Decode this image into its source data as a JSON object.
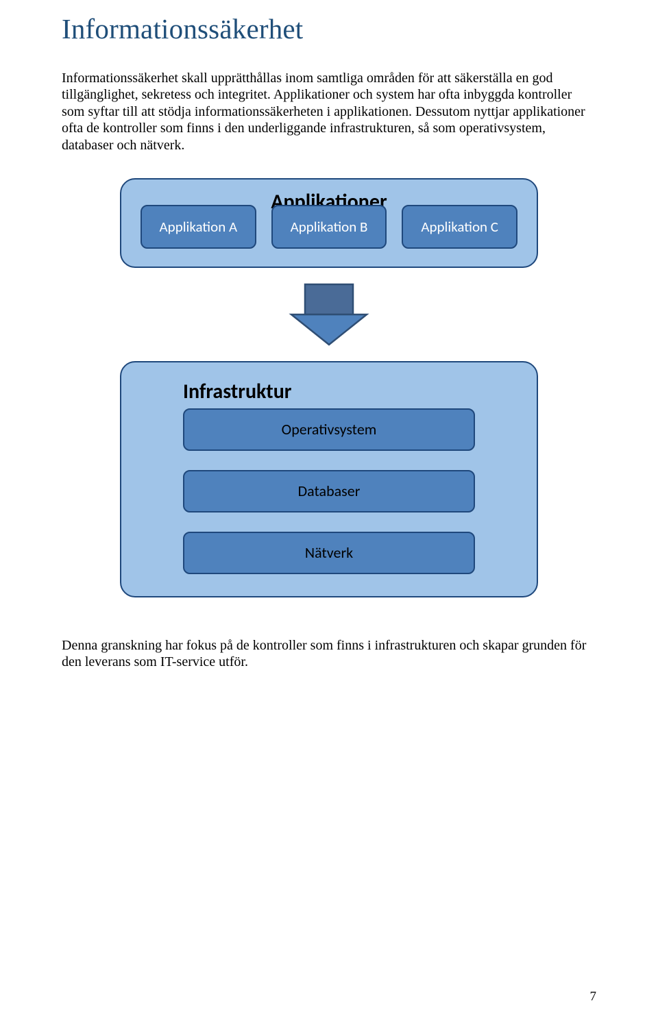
{
  "heading": "Informationssäkerhet",
  "paragraph1": "Informationssäkerhet skall upprätthållas inom samtliga områden för att säkerställa en god tillgänglighet, sekretess och integritet. Applikationer och system har ofta inbyggda kontroller som syftar till att stödja informationssäkerheten i applikationen. Dessutom nyttjar applikationer ofta de kontroller som finns i den underliggande infrastrukturen, så som operativsystem, databaser och nätverk.",
  "diagram": {
    "apps_panel_title": "Applikationer",
    "apps": [
      "Applikation A",
      "Applikation B",
      "Applikation C"
    ],
    "infra_panel_title": "Infrastruktur",
    "infra_items": [
      "Operativsystem",
      "Databaser",
      "Nätverk"
    ]
  },
  "paragraph2": "Denna granskning har fokus på de kontroller som finns i infrastrukturen och skapar grunden för den leverans som IT-service utför.",
  "page_number": "7"
}
